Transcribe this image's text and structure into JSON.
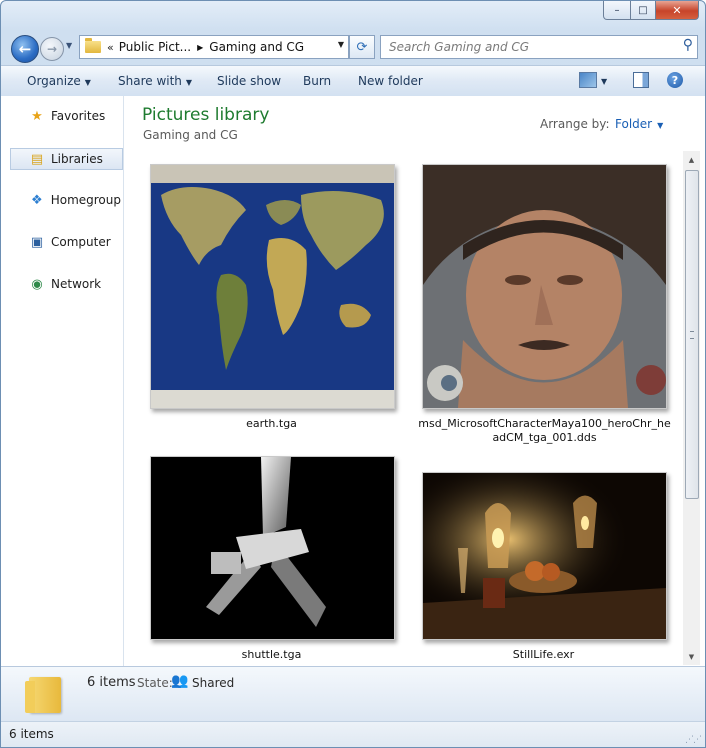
{
  "window": {
    "minimize": "–",
    "maximize": "□",
    "close": "✕"
  },
  "nav": {
    "back": "←",
    "forward": "→",
    "recent": "▼",
    "breadcrumb": {
      "overflow": "«",
      "crumbs": [
        "Public Pict...",
        "Gaming and CG"
      ]
    },
    "refresh": "⟳",
    "search_placeholder": "Search Gaming and CG",
    "search_glyph": "⚲"
  },
  "toolbar": {
    "organize": "Organize",
    "share_with": "Share with",
    "slide_show": "Slide show",
    "burn": "Burn",
    "new_folder": "New folder",
    "help": "?"
  },
  "sidebar": {
    "items": [
      {
        "label": "Favorites",
        "icon": "star-icon",
        "glyph": "★",
        "color": "#e8a317"
      },
      {
        "label": "Libraries",
        "icon": "libraries-icon",
        "glyph": "▤",
        "color": "#d9a520",
        "selected": true
      },
      {
        "label": "Homegroup",
        "icon": "homegroup-icon",
        "glyph": "❖",
        "color": "#2d7fd1"
      },
      {
        "label": "Computer",
        "icon": "computer-icon",
        "glyph": "▣",
        "color": "#2b5f9e"
      },
      {
        "label": "Network",
        "icon": "network-icon",
        "glyph": "◉",
        "color": "#2f8a4a"
      }
    ]
  },
  "library": {
    "title": "Pictures library",
    "subtitle": "Gaming and CG",
    "arrange_label": "Arrange by:",
    "arrange_value": "Folder"
  },
  "files": [
    {
      "name": "earth.tga"
    },
    {
      "name": "msd_MicrosoftCharacterMaya100_heroChr_headCM_tga_001.dds"
    },
    {
      "name": "shuttle.tga"
    },
    {
      "name": "StillLife.exr"
    }
  ],
  "details": {
    "count": "6 items",
    "state_label": "State:",
    "state_value": "Shared"
  },
  "status": {
    "text": "6 items"
  },
  "colors": {
    "title_green": "#1e7b2f",
    "link_blue": "#1a5fb4"
  }
}
